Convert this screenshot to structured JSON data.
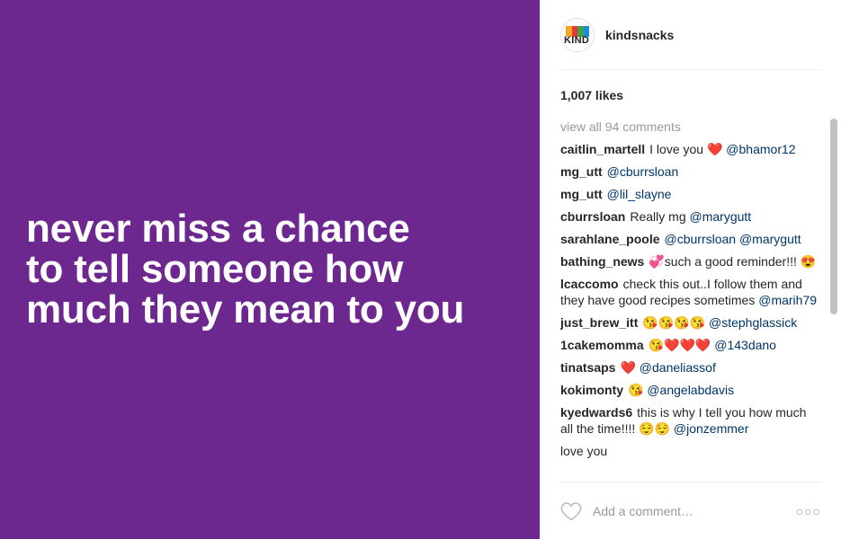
{
  "post": {
    "quote_lines": [
      "never miss a chance",
      "to tell someone how",
      "much they mean to you"
    ],
    "background_color": "#6d2890"
  },
  "header": {
    "avatar_text": "KIND",
    "username": "kindsnacks"
  },
  "likes": "1,007 likes",
  "view_all": "view all 94 comments",
  "comments": [
    {
      "user": "caitlin_martell",
      "text": "I love you ❤️",
      "mention": "@bhamor12"
    },
    {
      "user": "mg_utt",
      "text": "",
      "mention": "@cburrsloan"
    },
    {
      "user": "mg_utt",
      "text": "",
      "mention": "@lil_slayne"
    },
    {
      "user": "cburrsloan",
      "text": "Really mg",
      "mention": "@marygutt"
    },
    {
      "user": "sarahlane_poole",
      "text": "",
      "mention": "@cburrsloan @marygutt"
    },
    {
      "user": "bathing_news",
      "text": "💞such a good reminder!!! 😍",
      "mention": ""
    },
    {
      "user": "lcaccomo",
      "text": "check this out..I follow them and they have good recipes sometimes",
      "mention": "@marih79"
    },
    {
      "user": "just_brew_itt",
      "text": "😘😘😘😘",
      "mention": "@stephglassick"
    },
    {
      "user": "1cakemomma",
      "text": "😘❤️❤️❤️",
      "mention": "@143dano"
    },
    {
      "user": "tinatsaps",
      "text": "❤️",
      "mention": "@daneliassof"
    },
    {
      "user": "kokimonty",
      "text": "😘",
      "mention": "@angelabdavis"
    },
    {
      "user": "kyedwards6",
      "text": "this is why I tell you how much all the time!!!! 😌😌",
      "mention": "@jonzemmer"
    },
    {
      "user": "",
      "text": "love you",
      "mention": ""
    }
  ],
  "footer": {
    "placeholder": "Add a comment…",
    "more": "○○○"
  },
  "icons": {
    "like": "heart-outline-icon",
    "more": "more-options-icon"
  },
  "colors": {
    "mention": "#003569",
    "muted": "#999999",
    "kind_bars": [
      "#f5a623",
      "#e53935",
      "#43a047",
      "#1e88e5"
    ]
  }
}
